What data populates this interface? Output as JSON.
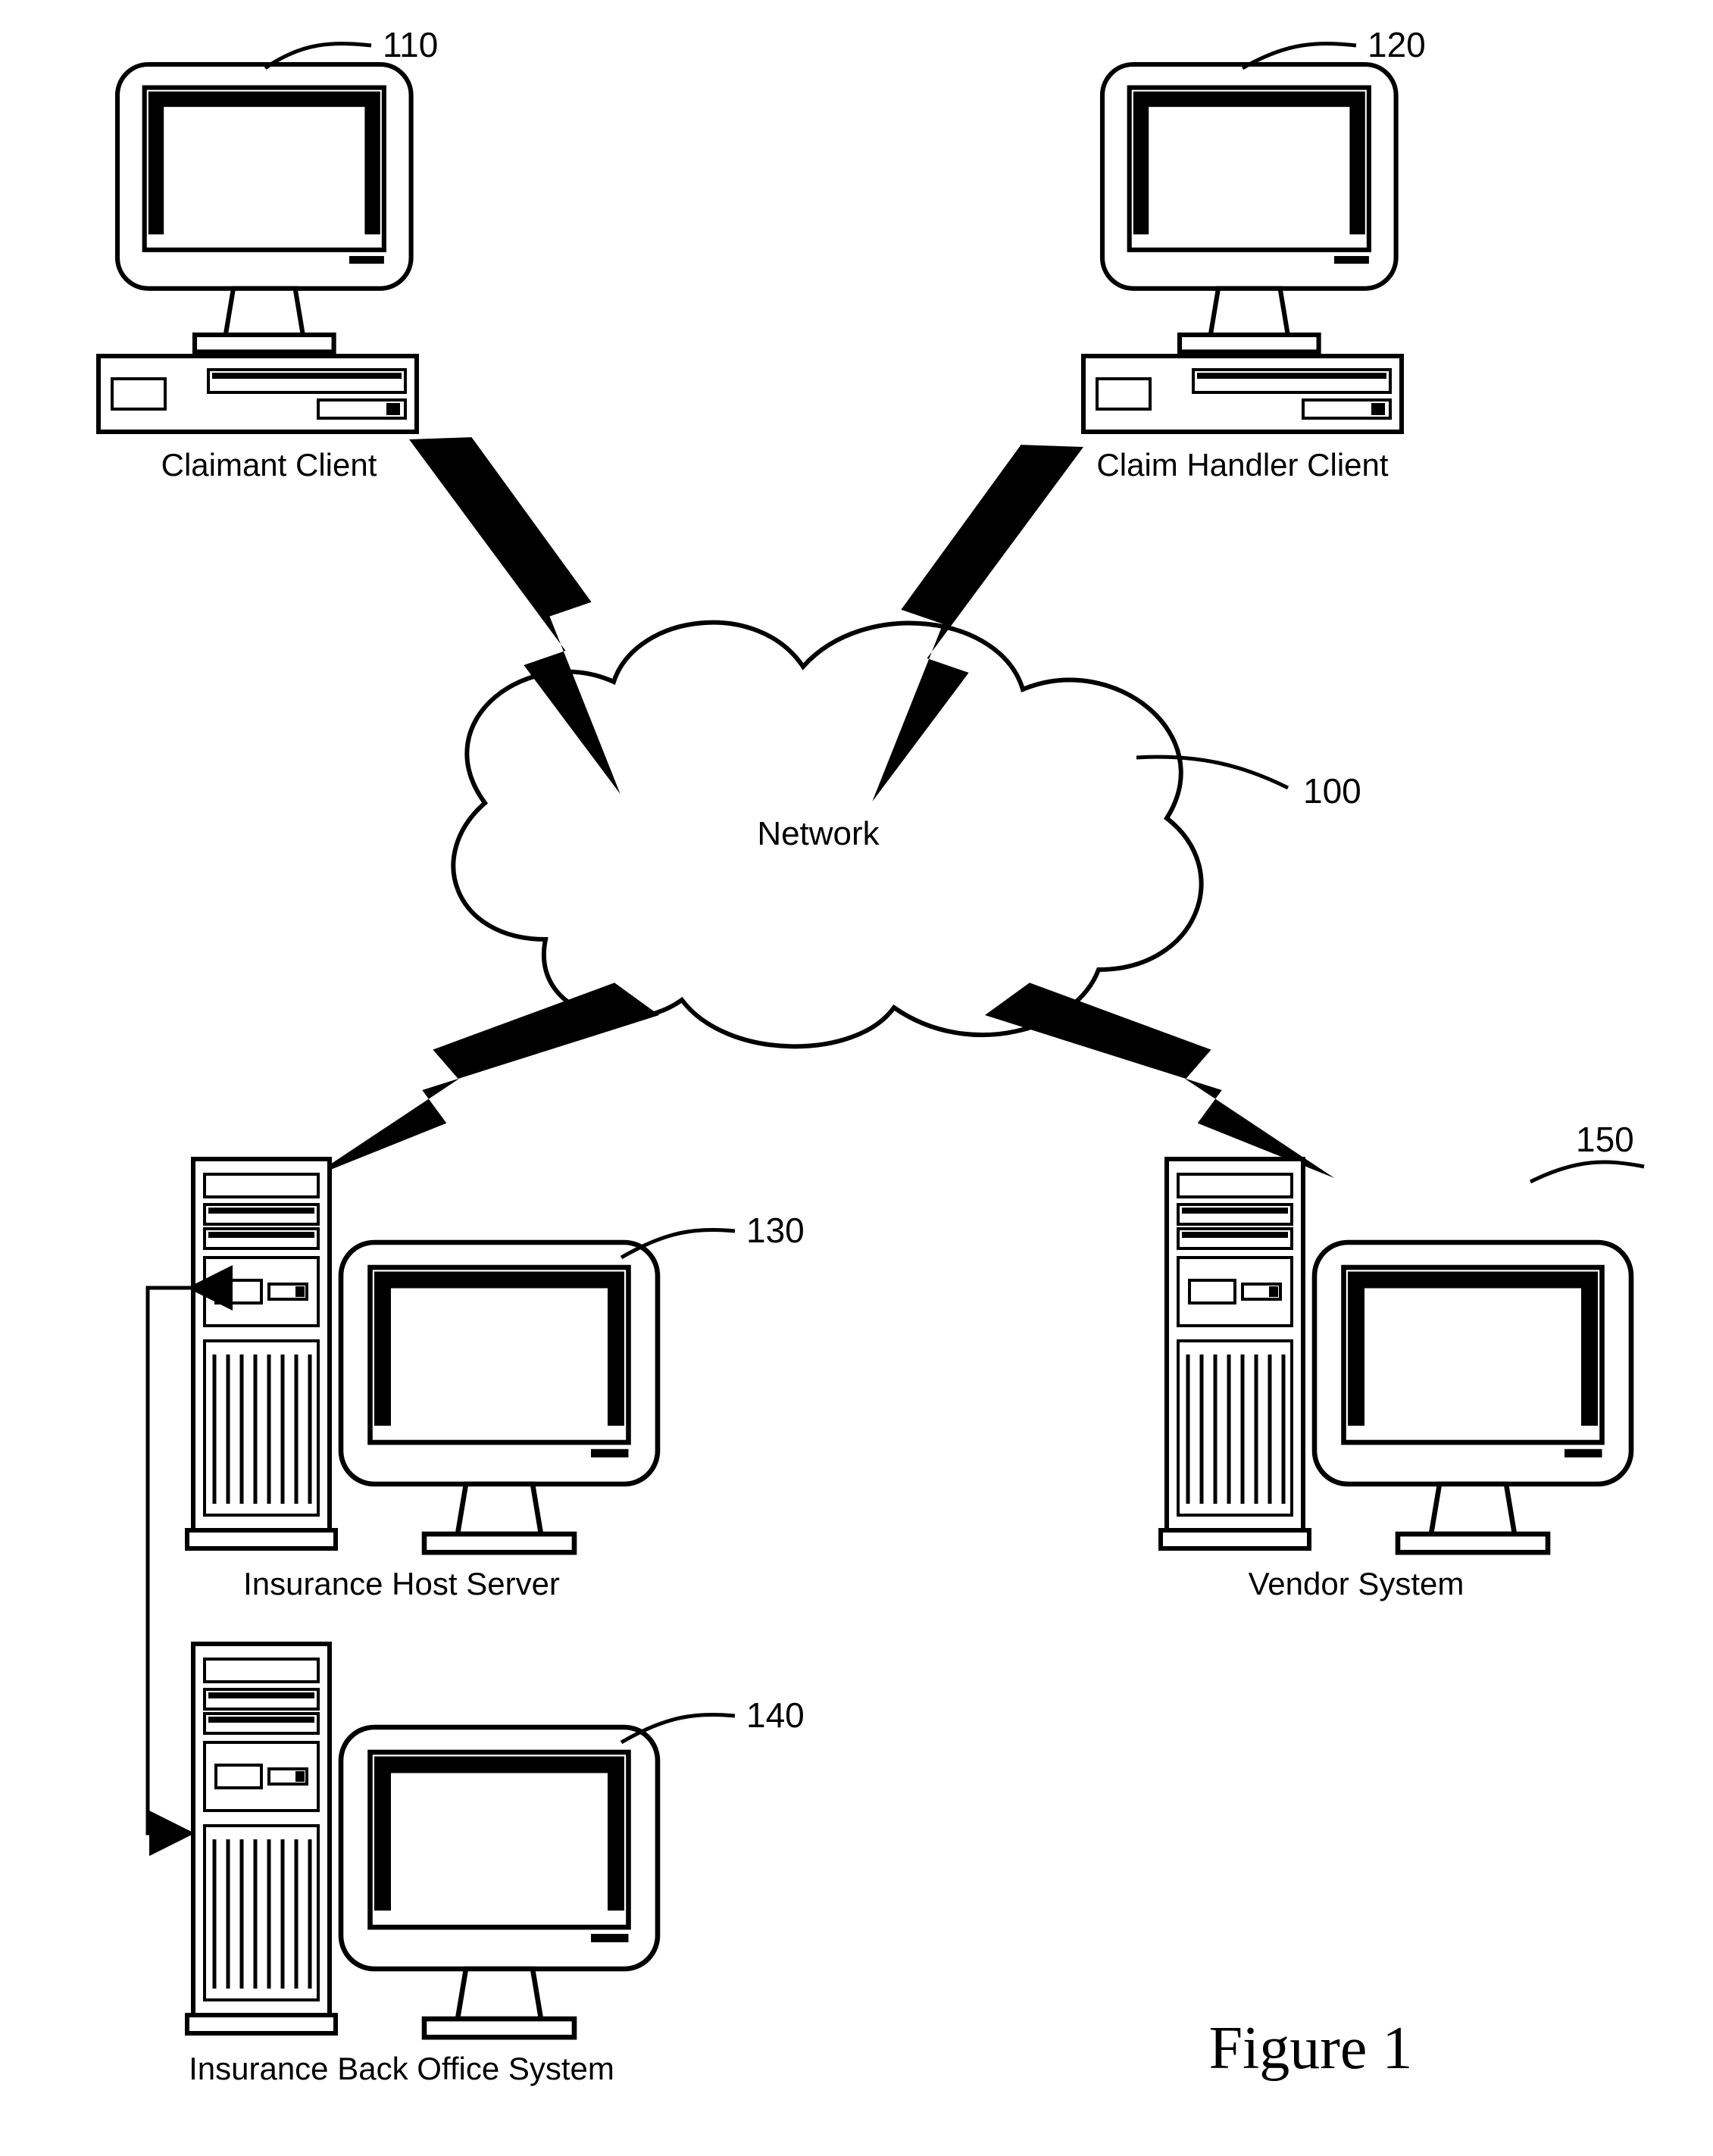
{
  "nodes": {
    "claimant": {
      "label": "Claimant Client",
      "ref": "110"
    },
    "handler": {
      "label": "Claim Handler Client",
      "ref": "120"
    },
    "network": {
      "label": "Network",
      "ref": "100"
    },
    "host": {
      "label": "Insurance Host Server",
      "ref": "130"
    },
    "backoffice": {
      "label": "Insurance Back Office System",
      "ref": "140"
    },
    "vendor": {
      "label": "Vendor System",
      "ref": "150"
    }
  },
  "figure": "Figure 1"
}
